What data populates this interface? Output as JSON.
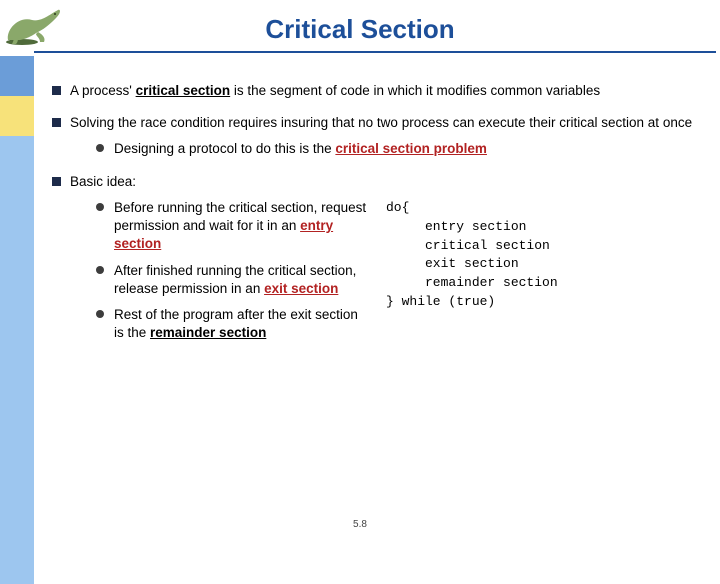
{
  "title": "Critical Section",
  "logo_alt": "dinosaur-mascot",
  "bullets": {
    "b1_a": "A process' ",
    "b1_cs": "critical section",
    "b1_b": " is the segment of code in which it modifies common variables",
    "b2": "Solving the race condition requires insuring that no two process can execute their critical section at once",
    "b2_1_a": "Designing a protocol to do this is the ",
    "b2_1_csp": "critical section problem",
    "b3": "Basic idea:",
    "b3_1_a": "Before running the critical section, request permission and wait for it in an ",
    "b3_1_entry": "entry section",
    "b3_2_a": "After finished running the critical section,  release permission in an ",
    "b3_2_exit": "exit section",
    "b3_3_a": "Rest of the program after the exit section is the ",
    "b3_3_rem": "remainder section"
  },
  "code": {
    "l1": "do{",
    "l2": "     entry section",
    "l3": "     critical section",
    "l4": "     exit section",
    "l5": "     remainder section",
    "l6": "} while (true)"
  },
  "page_number": "5.8"
}
